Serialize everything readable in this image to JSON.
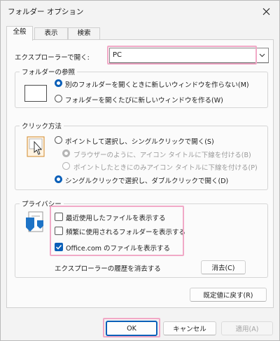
{
  "window": {
    "title": "フォルダー オプション"
  },
  "tabs": [
    {
      "label": "全般"
    },
    {
      "label": "表示"
    },
    {
      "label": "検索"
    }
  ],
  "open_explorer": {
    "label": "エクスプローラーで開く:",
    "value": "PC"
  },
  "browse_folders": {
    "title": "フォルダーの参照",
    "options": [
      {
        "label": "別のフォルダーを開くときに新しいウィンドウを作らない(M)",
        "checked": true
      },
      {
        "label": "フォルダーを開くたびに新しいウィンドウを作る(W)",
        "checked": false
      }
    ]
  },
  "click_method": {
    "title": "クリック方法",
    "option_single": "ポイントして選択し、シングルクリックで開く(S)",
    "sub_options": [
      "ブラウザーのように、アイコン タイトルに下線を付ける(B)",
      "ポイントしたときにのみアイコン タイトルに下線を付ける(P)"
    ],
    "option_double": "シングルクリックで選択し、ダブルクリックで開く(D)"
  },
  "privacy": {
    "title": "プライバシー",
    "checkboxes": [
      {
        "label": "最近使用したファイルを表示する",
        "checked": false
      },
      {
        "label": "頻繁に使用されるフォルダーを表示する",
        "checked": false
      },
      {
        "label": "Office.com のファイルを表示する",
        "checked": true
      }
    ],
    "clear_label": "エクスプローラーの履歴を消去する",
    "clear_button": "消去(C)"
  },
  "restore_defaults": "既定値に戻す(R)",
  "footer": {
    "ok": "OK",
    "cancel": "キャンセル",
    "apply": "適用(A)"
  },
  "colors": {
    "accent": "#0a5fb8",
    "highlight": "#f1a9c7",
    "window_bg": "#f3f3f3",
    "panel_bg": "#fbfbfb"
  }
}
